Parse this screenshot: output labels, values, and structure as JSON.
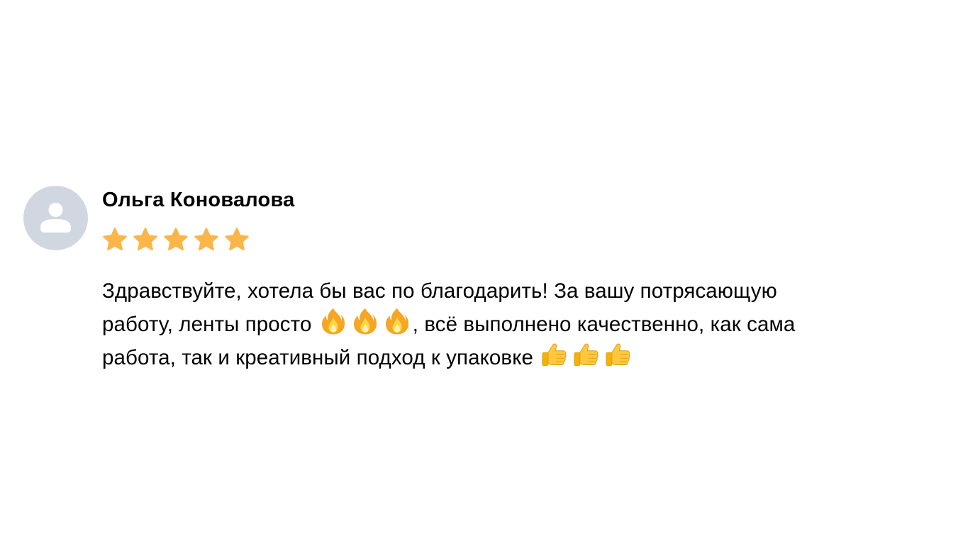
{
  "review": {
    "author": "Ольга Коновалова",
    "rating": 5,
    "rating_max": 5,
    "star_color": "#FBB549",
    "avatar_bg": "#D1D7E0",
    "avatar_icon_color": "#ffffff",
    "avatar_icon": "user-silhouette-icon",
    "text_lines": [
      {
        "before": "Здравствуйте, хотела бы вас по благодарить! За вашу потрясающую",
        "emoji": "",
        "emoji_count": 0,
        "after": ""
      },
      {
        "before": "работу, ленты просто ",
        "emoji": "fire-icon",
        "emoji_count": 3,
        "after": ", всё выполнено качественно, как сама"
      },
      {
        "before": "работа, так и креативный подход к упаковке ",
        "emoji": "thumbs-up-icon",
        "emoji_count": 3,
        "after": ""
      }
    ]
  }
}
